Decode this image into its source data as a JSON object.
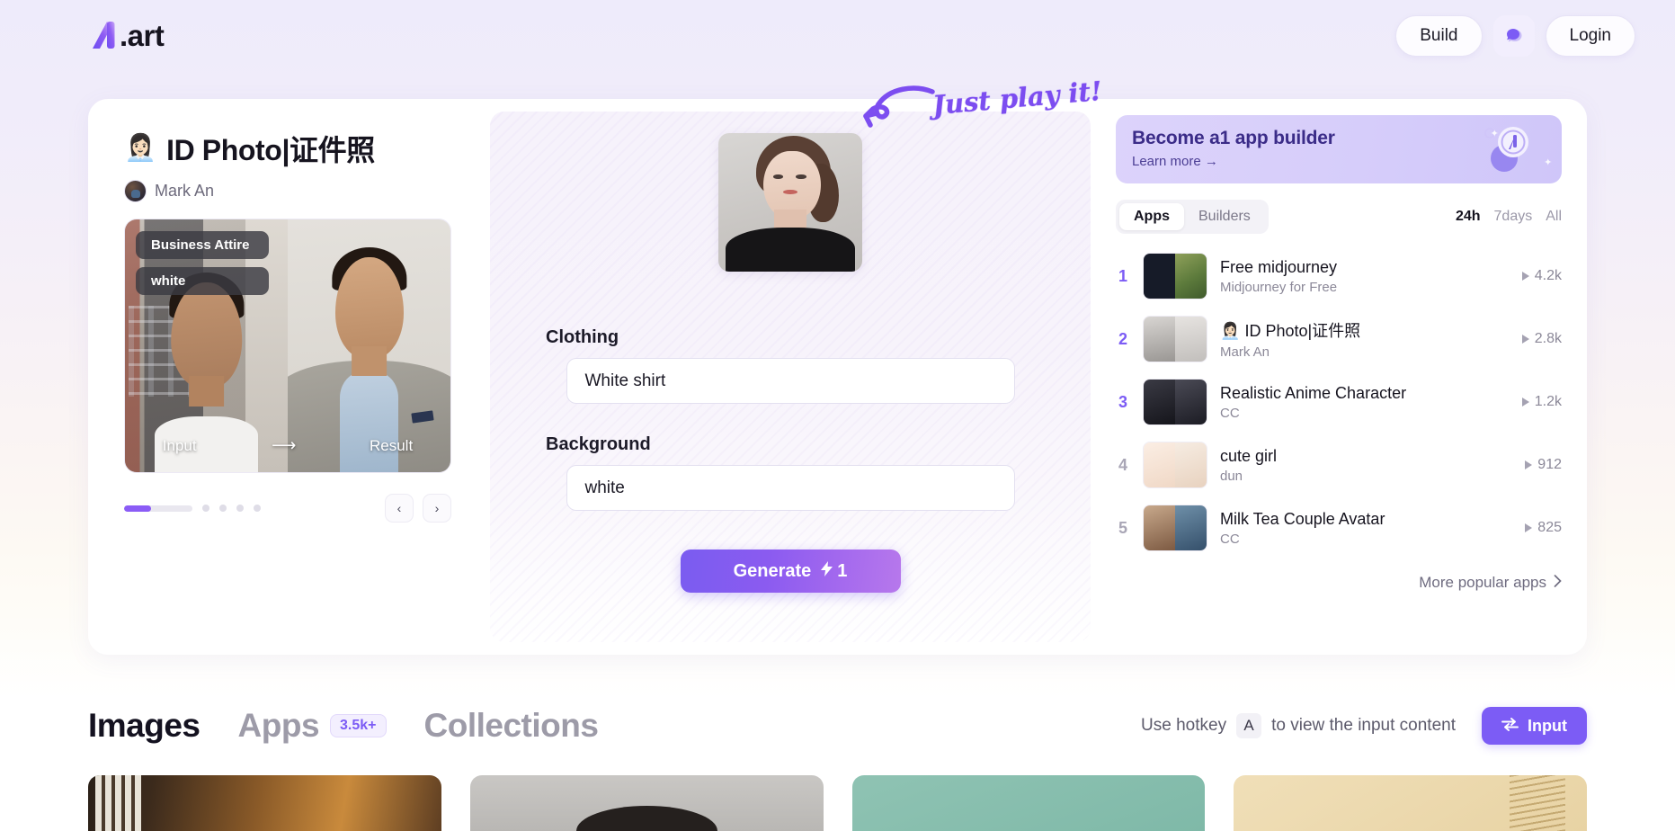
{
  "header": {
    "logo_text": ".art",
    "build_label": "Build",
    "login_label": "Login",
    "chat_icon": "chat-bubble-icon"
  },
  "app": {
    "emoji": "👩🏻‍💼",
    "title": "ID Photo|证件照",
    "author": "Mark An",
    "carousel": {
      "chips": [
        "Business Attire",
        "white"
      ],
      "input_label": "Input",
      "result_label": "Result",
      "arrow": "⟶",
      "prev_icon": "‹",
      "next_icon": "›",
      "progress_percent": 40,
      "dot_count": 4
    }
  },
  "form": {
    "fields": [
      {
        "label": "Clothing",
        "value": "White shirt"
      },
      {
        "label": "Background",
        "value": "white"
      }
    ],
    "generate_label": "Generate",
    "generate_cost": "1",
    "bolt_icon": "⚡"
  },
  "annotation": {
    "text": "Just play it!",
    "arrow_icon": "curved-arrow-icon"
  },
  "promo": {
    "title": "Become a1 app builder",
    "subtitle": "Learn more →"
  },
  "ranking": {
    "tabs": [
      {
        "label": "Apps",
        "active": true
      },
      {
        "label": "Builders",
        "active": false
      }
    ],
    "filters": [
      {
        "label": "24h",
        "active": true
      },
      {
        "label": "7days",
        "active": false
      },
      {
        "label": "All",
        "active": false
      }
    ],
    "items": [
      {
        "rank": "1",
        "title": "Free midjourney",
        "author": "Midjourney for Free",
        "runs": "4.2k",
        "emoji": ""
      },
      {
        "rank": "2",
        "title": "ID Photo|证件照",
        "author": "Mark An",
        "runs": "2.8k",
        "emoji": "👩🏻‍💼"
      },
      {
        "rank": "3",
        "title": "Realistic Anime Character",
        "author": "CC",
        "runs": "1.2k",
        "emoji": ""
      },
      {
        "rank": "4",
        "title": "cute girl",
        "author": "dun",
        "runs": "912",
        "emoji": ""
      },
      {
        "rank": "5",
        "title": "Milk Tea Couple Avatar",
        "author": "CC",
        "runs": "825",
        "emoji": ""
      }
    ],
    "more_label": "More popular apps",
    "more_icon": "chevron-right-icon"
  },
  "bottom": {
    "tabs": [
      {
        "label": "Images",
        "active": true,
        "badge": ""
      },
      {
        "label": "Apps",
        "active": false,
        "badge": "3.5k+"
      },
      {
        "label": "Collections",
        "active": false,
        "badge": ""
      }
    ],
    "hint_prefix": "Use hotkey",
    "hint_key": "A",
    "hint_suffix": "to view the input content",
    "input_label": "Input",
    "input_icon": "⇄"
  },
  "colors": {
    "accent": "#7C5CF5",
    "accent_light": "#A268EE",
    "bg_top": "#EEEBFB",
    "text_dark": "#16141F",
    "text_muted": "#8B8898"
  }
}
